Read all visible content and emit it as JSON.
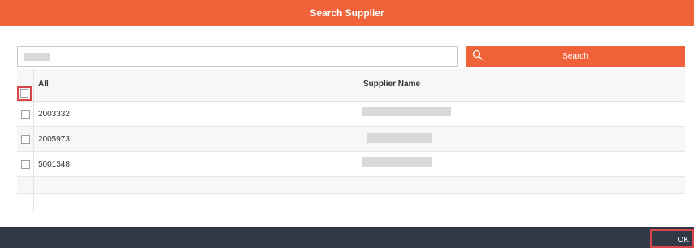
{
  "dialog": {
    "title": "Search Supplier"
  },
  "search": {
    "button_label": "Search",
    "icon": "search-icon"
  },
  "table": {
    "columns": [
      "All",
      "Supplier Name"
    ],
    "rows": [
      {
        "id": "2003332",
        "supplier_name": ""
      },
      {
        "id": "2005973",
        "supplier_name": ""
      },
      {
        "id": "5001348",
        "supplier_name": ""
      }
    ]
  },
  "footer": {
    "ok_label": "OK"
  },
  "colors": {
    "accent": "#f0633a",
    "footer": "#2f3844",
    "highlight": "#d8464a"
  }
}
